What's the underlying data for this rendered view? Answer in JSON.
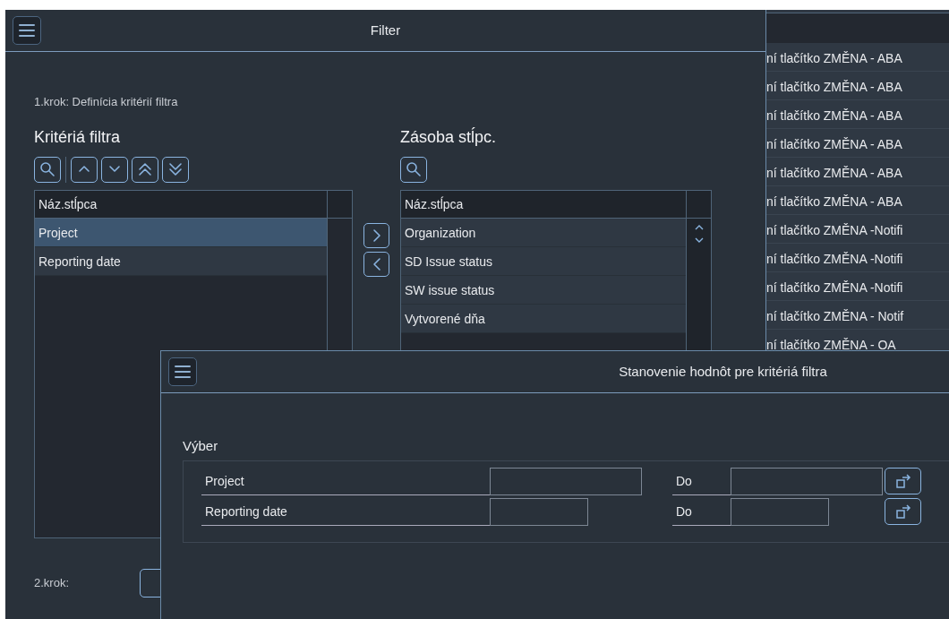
{
  "filter_window": {
    "title": "Filter",
    "step1_label": "1.krok: Definícia kritérií filtra",
    "criteria": {
      "heading": "Kritériá filtra",
      "toolbar": [
        {
          "kind": "search"
        },
        {
          "kind": "up"
        },
        {
          "kind": "down"
        },
        {
          "kind": "top"
        },
        {
          "kind": "bottom"
        }
      ],
      "column": "Náz.stĺpca",
      "rows": [
        {
          "label": "Project",
          "selected": true
        },
        {
          "label": "Reporting date",
          "selected": false
        }
      ]
    },
    "move_buttons": [
      {
        "kind": "right"
      },
      {
        "kind": "left"
      }
    ],
    "column_pool": {
      "heading": "Zásoba stĺpc.",
      "toolbar": [
        {
          "kind": "search"
        }
      ],
      "column": "Náz.stĺpca",
      "rows": [
        {
          "label": "Organization",
          "selected": false
        },
        {
          "label": "SD Issue status",
          "selected": false
        },
        {
          "label": "SW issue status",
          "selected": false
        },
        {
          "label": "Vytvorené dňa",
          "selected": false
        }
      ]
    },
    "step2_label": "2.krok:"
  },
  "background_table": {
    "rows": [
      "ní tlačítko ZMĚNA - ABA",
      "ní tlačítko ZMĚNA - ABA",
      "ní tlačítko ZMĚNA - ABA",
      "ní tlačítko ZMĚNA - ABA",
      "ní tlačítko ZMĚNA - ABA",
      "ní tlačítko ZMĚNA - ABA",
      "ní tlačítko ZMĚNA -Notifi",
      "ní tlačítko ZMĚNA -Notifi",
      "ní tlačítko ZMĚNA -Notifi",
      "ní tlačítko ZMĚNA - Notif",
      "ní tlačítko ZMĚNA - OA"
    ]
  },
  "values_dialog": {
    "title": "Stanovenie hodnôt pre kritériá filtra",
    "group_title": "Výber",
    "rows": [
      {
        "label": "Project",
        "kind": "text",
        "to_label": "Do"
      },
      {
        "label": "Reporting date",
        "kind": "date",
        "to_label": "Do"
      }
    ]
  }
}
